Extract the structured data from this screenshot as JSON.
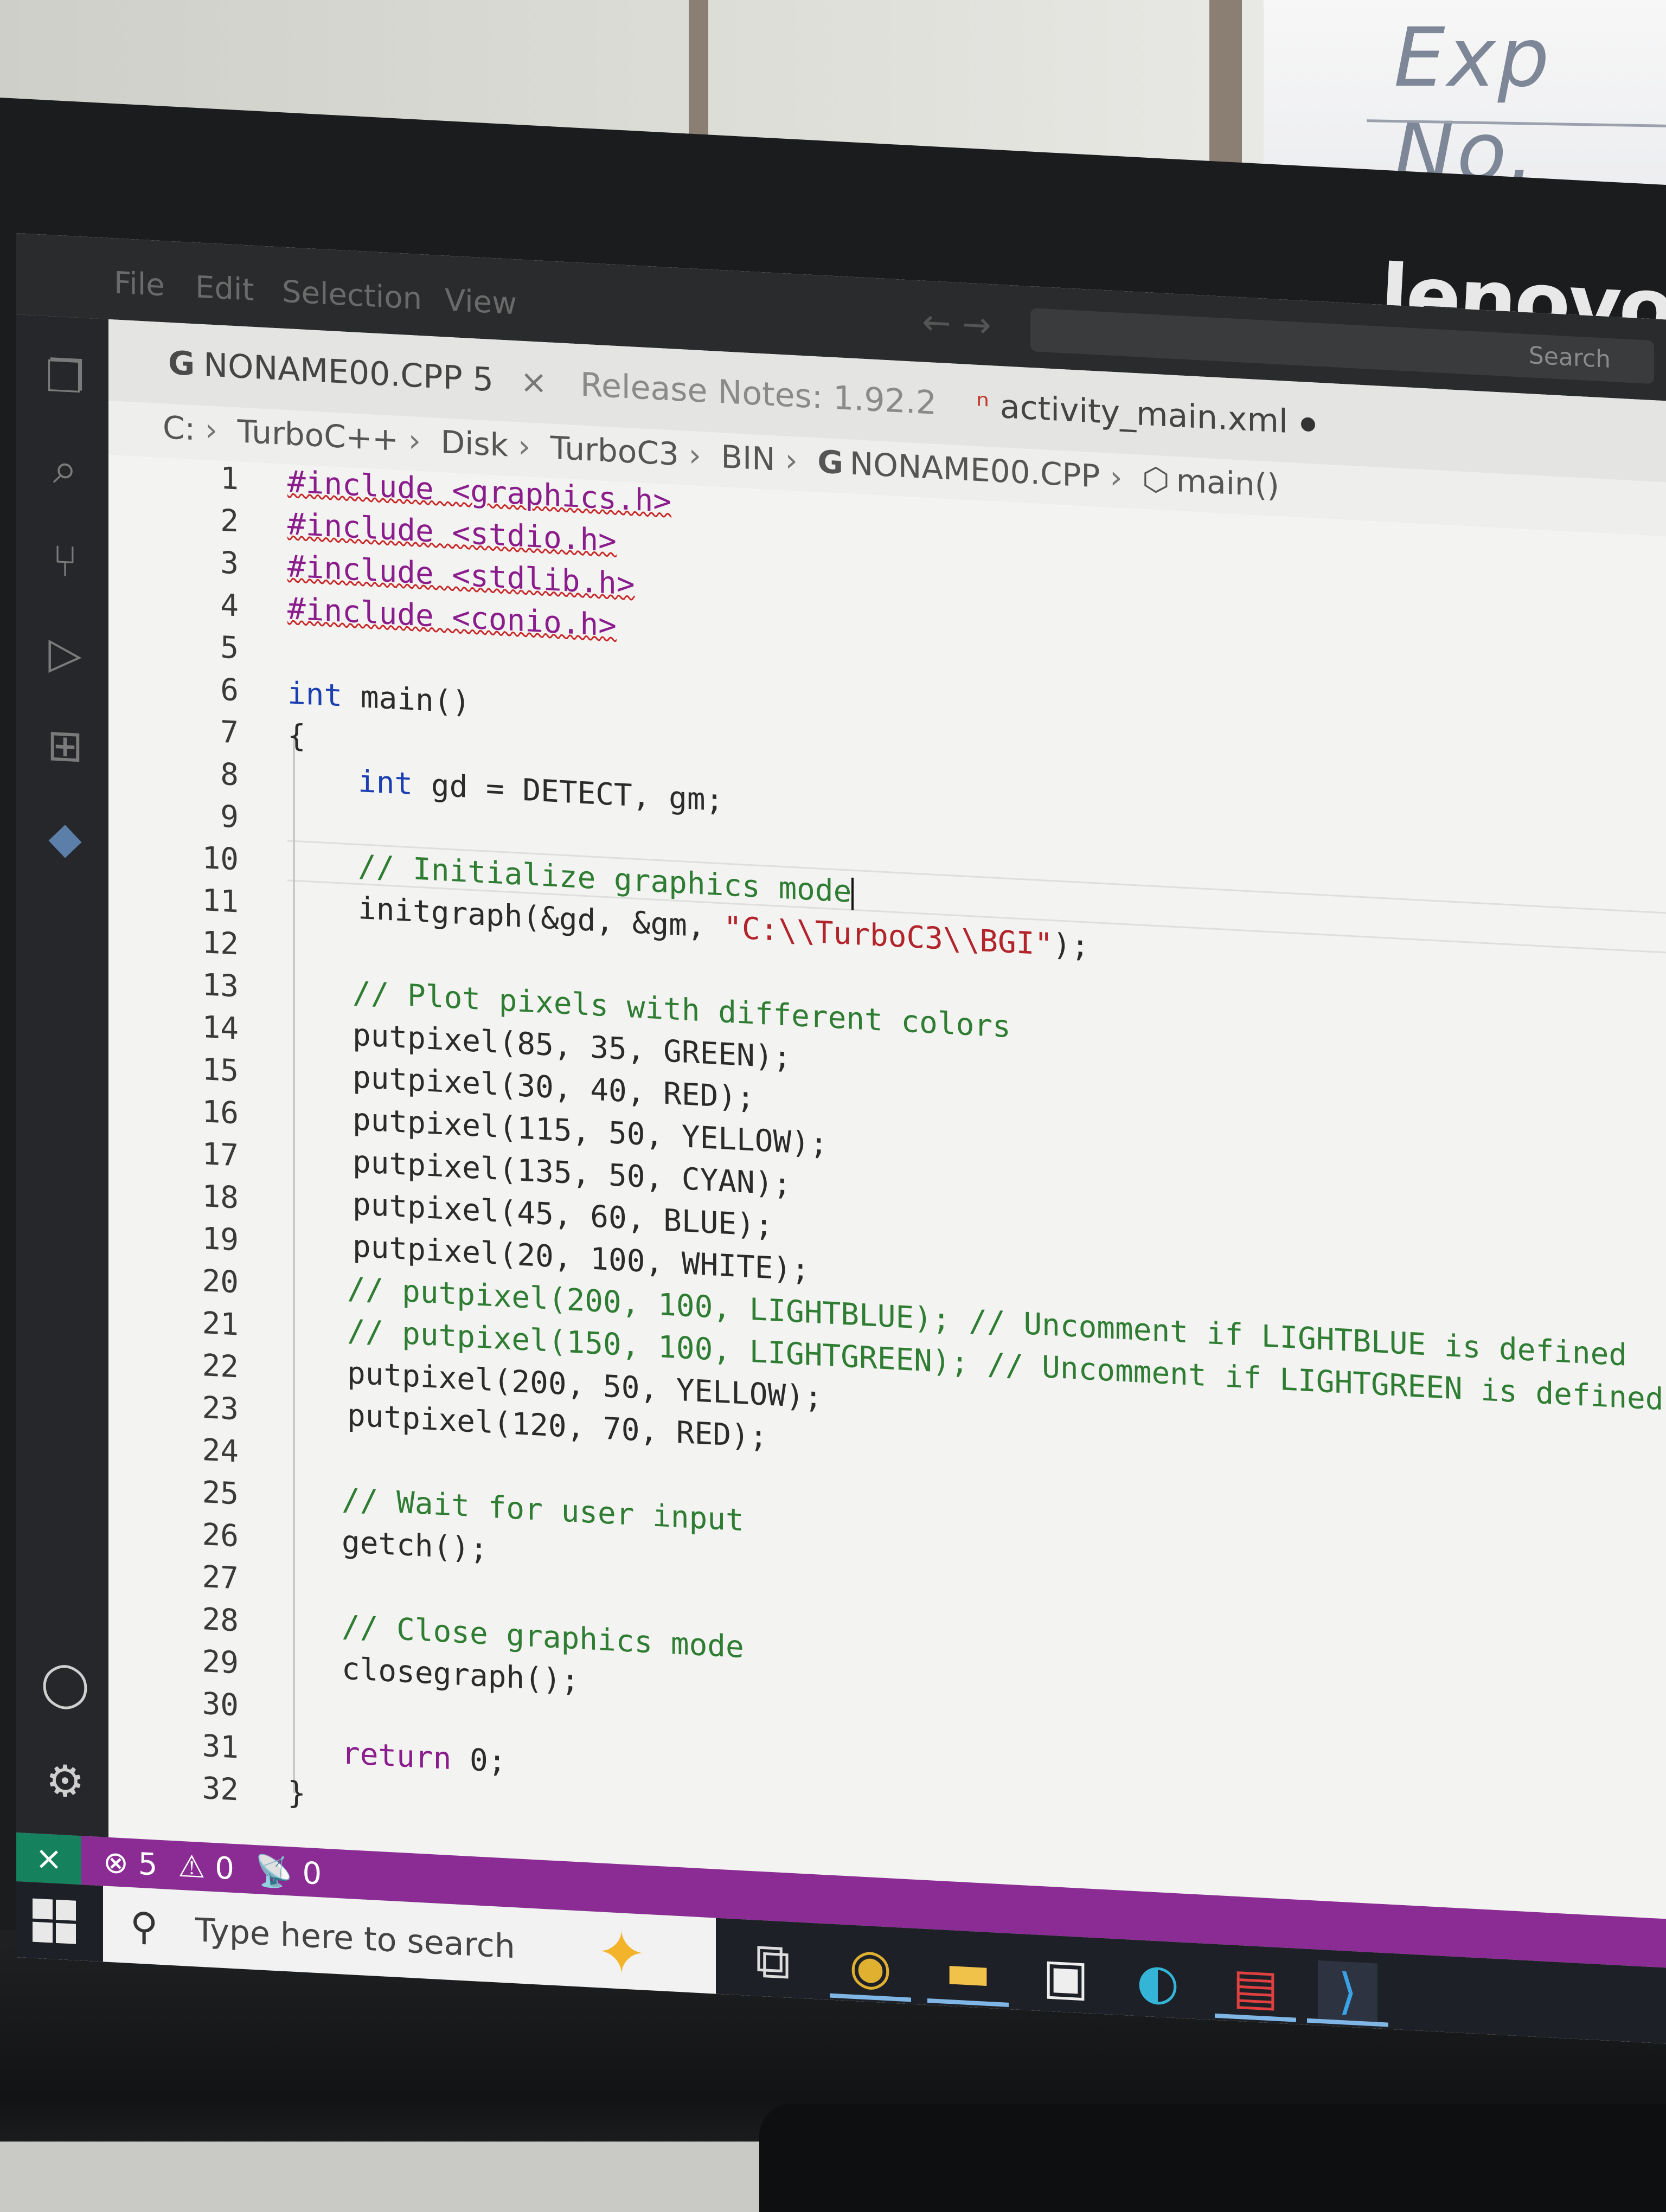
{
  "board": {
    "text": "Exp No."
  },
  "monitor": {
    "brand": "lenovo"
  },
  "titlebar": {
    "menu": [
      "File",
      "Edit",
      "Selection",
      "View"
    ],
    "search_placeholder": "Search"
  },
  "tabs": [
    {
      "label": "NONAME00.CPP 5",
      "close": "×"
    },
    {
      "label": "Release Notes: 1.92.2"
    },
    {
      "label": "activity_main.xml"
    }
  ],
  "breadcrumb": [
    "C:",
    "TurboC++",
    "Disk",
    "TurboC3",
    "BIN",
    "NONAME00.CPP",
    "main()"
  ],
  "editor": {
    "line_numbers": [
      "1",
      "2",
      "3",
      "4",
      "5",
      "6",
      "7",
      "8",
      "9",
      "10",
      "11",
      "12",
      "13",
      "14",
      "15",
      "16",
      "17",
      "18",
      "19",
      "20",
      "21",
      "22",
      "23",
      "24",
      "25",
      "26",
      "27",
      "28",
      "29",
      "30",
      "31",
      "32"
    ],
    "code": {
      "l1": "#include <graphics.h>",
      "l2": "#include <stdio.h>",
      "l3": "#include <stdlib.h>",
      "l4": "#include <conio.h>",
      "l6_kw": "int",
      "l6_rest": " main()",
      "l7": "{",
      "l8_kw": "int",
      "l8_rest": " gd = DETECT, gm;",
      "l10": "// Initialize graphics mode",
      "l11_a": "initgraph(&gd, &gm, ",
      "l11_str": "\"C:\\\\TurboC3\\\\BGI\"",
      "l11_b": ");",
      "l13": "// Plot pixels with different colors",
      "l14": "putpixel(85, 35, GREEN);",
      "l15": "putpixel(30, 40, RED);",
      "l16": "putpixel(115, 50, YELLOW);",
      "l17": "putpixel(135, 50, CYAN);",
      "l18": "putpixel(45, 60, BLUE);",
      "l19": "putpixel(20, 100, WHITE);",
      "l20": "// putpixel(200, 100, LIGHTBLUE); // Uncomment if LIGHTBLUE is defined",
      "l21": "// putpixel(150, 100, LIGHTGREEN); // Uncomment if LIGHTGREEN is defined",
      "l22": "putpixel(200, 50, YELLOW);",
      "l23": "putpixel(120, 70, RED);",
      "l25": "// Wait for user input",
      "l26": "getch();",
      "l28": "// Close graphics mode",
      "l29": "closegraph();",
      "l31_kw": "return",
      "l31_rest": " 0;",
      "l32": "}"
    }
  },
  "statusbar": {
    "errors": "5",
    "warnings": "0",
    "ports": "0",
    "color": "#8a2c93"
  },
  "taskbar": {
    "search_placeholder": "Type here to search",
    "apps": [
      "task-view-icon",
      "chrome-icon",
      "file-explorer-icon",
      "store-icon",
      "edge-icon",
      "media-app-icon",
      "vscode-icon"
    ]
  }
}
